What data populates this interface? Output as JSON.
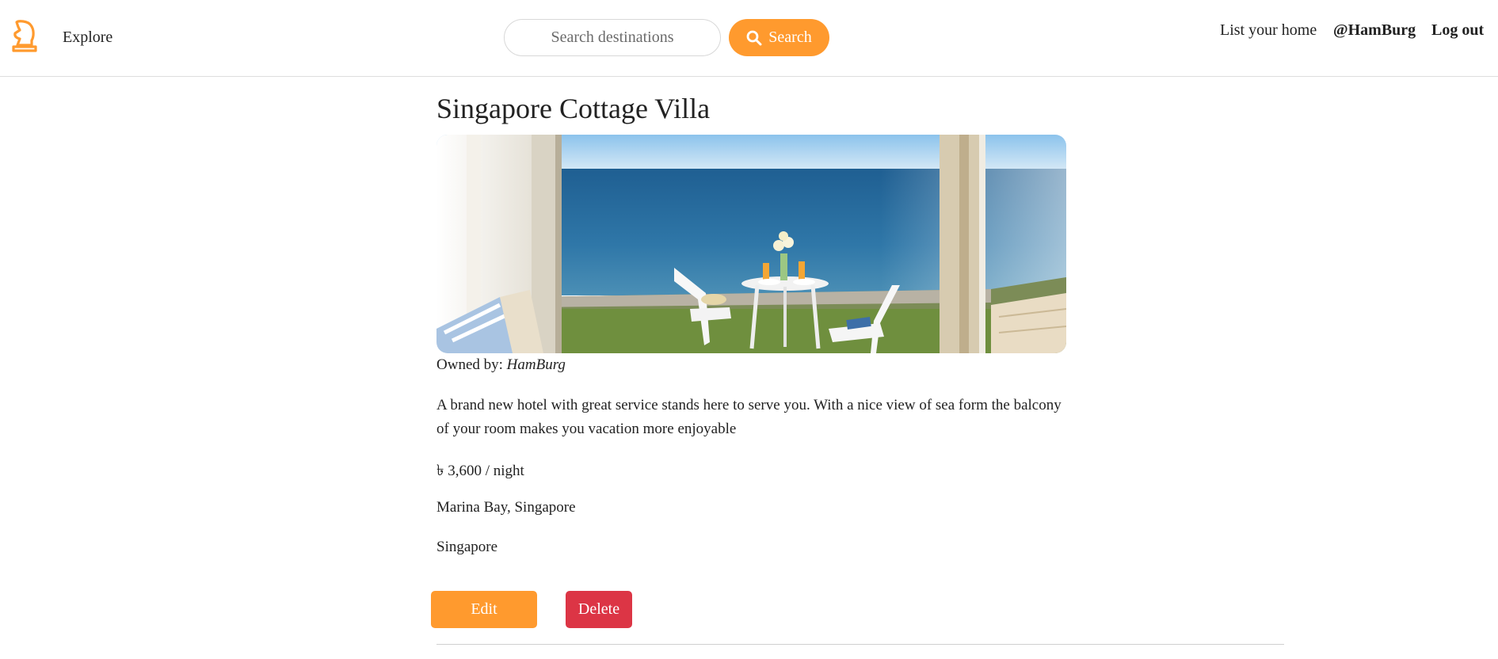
{
  "header": {
    "logo_icon": "chess-knight-icon",
    "explore_label": "Explore",
    "search": {
      "placeholder": "Search destinations",
      "button_label": "Search",
      "button_icon": "search-icon"
    },
    "list_home_label": "List your home",
    "username_label": "@HamBurg",
    "logout_label": "Log out"
  },
  "listing": {
    "title": "Singapore Cottage Villa",
    "image_alt": "sea-view-balcony-photo",
    "owner_prefix": "Owned by:",
    "owner_name": "HamBurg",
    "description": "A brand new hotel with great service stands here to serve you. With a nice view of sea form the balcony of your room makes you vacation more enjoyable",
    "price": "৳ 3,600 / night",
    "location": "Marina Bay, Singapore",
    "country": "Singapore"
  },
  "actions": {
    "edit_label": "Edit",
    "delete_label": "Delete"
  },
  "colors": {
    "accent": "#ff9a2e",
    "danger": "#dc3545",
    "text": "#222222"
  }
}
